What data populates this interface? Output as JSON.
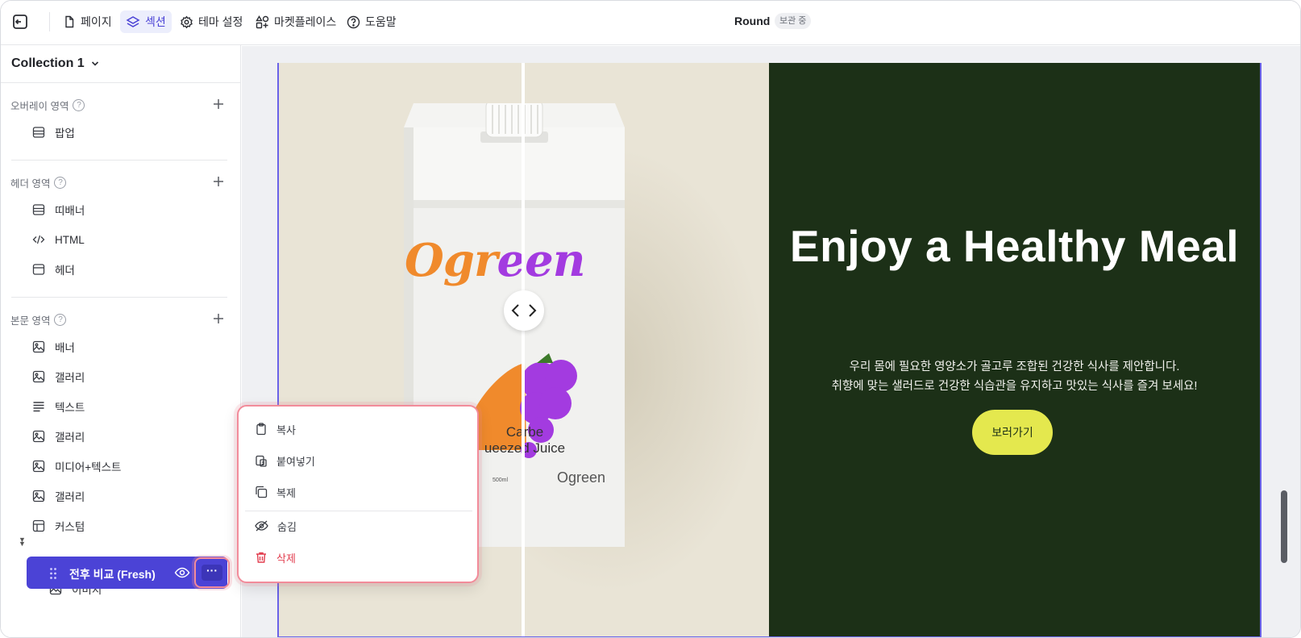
{
  "topbar": {
    "tabs": [
      {
        "label": "페이지",
        "icon": "file-icon"
      },
      {
        "label": "섹션",
        "icon": "layers-icon",
        "active": true
      },
      {
        "label": "테마 설정",
        "icon": "gear-icon"
      },
      {
        "label": "마켓플레이스",
        "icon": "apps-plus-icon"
      },
      {
        "label": "도움말",
        "icon": "help-circle-icon"
      }
    ],
    "title": "Round",
    "badge": "보관 중"
  },
  "sidebar": {
    "collection": "Collection 1",
    "groups": [
      {
        "label": "오버레이 영역",
        "items": [
          {
            "label": "팝업",
            "icon": "layout-icon"
          }
        ]
      },
      {
        "label": "헤더 영역",
        "items": [
          {
            "label": "띠배너",
            "icon": "layout-icon"
          },
          {
            "label": "HTML",
            "icon": "code-icon"
          },
          {
            "label": "헤더",
            "icon": "header-icon"
          }
        ]
      },
      {
        "label": "본문 영역",
        "items": [
          {
            "label": "배너",
            "icon": "image-icon"
          },
          {
            "label": "갤러리",
            "icon": "image-icon"
          },
          {
            "label": "텍스트",
            "icon": "text-icon"
          },
          {
            "label": "갤러리",
            "icon": "image-icon"
          },
          {
            "label": "미디어+텍스트",
            "icon": "image-icon"
          },
          {
            "label": "갤러리",
            "icon": "image-icon"
          },
          {
            "label": "커스텀",
            "icon": "custom-layout-icon"
          }
        ]
      }
    ],
    "selected": {
      "label": "전후 비교 (Fresh)",
      "more_label": "···"
    },
    "child": {
      "label": "이미지",
      "icon": "image-icon"
    }
  },
  "hero": {
    "title": "Enjoy a Healthy Meal",
    "description_line1": "우리 몸에 필요한 영양소가 골고루 조합된 건강한 식사를 제안합니다.",
    "description_line2": "취향에 맞는 샐러드로 건강한 식습관을 유지하고 맛있는 식사를 즐겨 보세요!",
    "button": "보러가기",
    "product_brand": "Ogreen",
    "product_line1": "Carbe",
    "product_line2": "ueezed Juice",
    "product_volume": "500ml"
  },
  "context_menu": {
    "items": [
      {
        "label": "복사",
        "icon": "clipboard-icon"
      },
      {
        "label": "붙여넣기",
        "icon": "paste-icon"
      },
      {
        "label": "복제",
        "icon": "duplicate-icon"
      },
      {
        "label": "숨김",
        "icon": "eye-off-icon"
      },
      {
        "label": "삭제",
        "icon": "trash-icon",
        "danger": true
      }
    ]
  },
  "colors": {
    "accent": "#4b43d6",
    "hero_dark": "#1c3017",
    "hero_button": "#e4e84e",
    "danger": "#e23d4e",
    "brand_orange": "#f08a2c",
    "brand_purple": "#a33be0"
  }
}
